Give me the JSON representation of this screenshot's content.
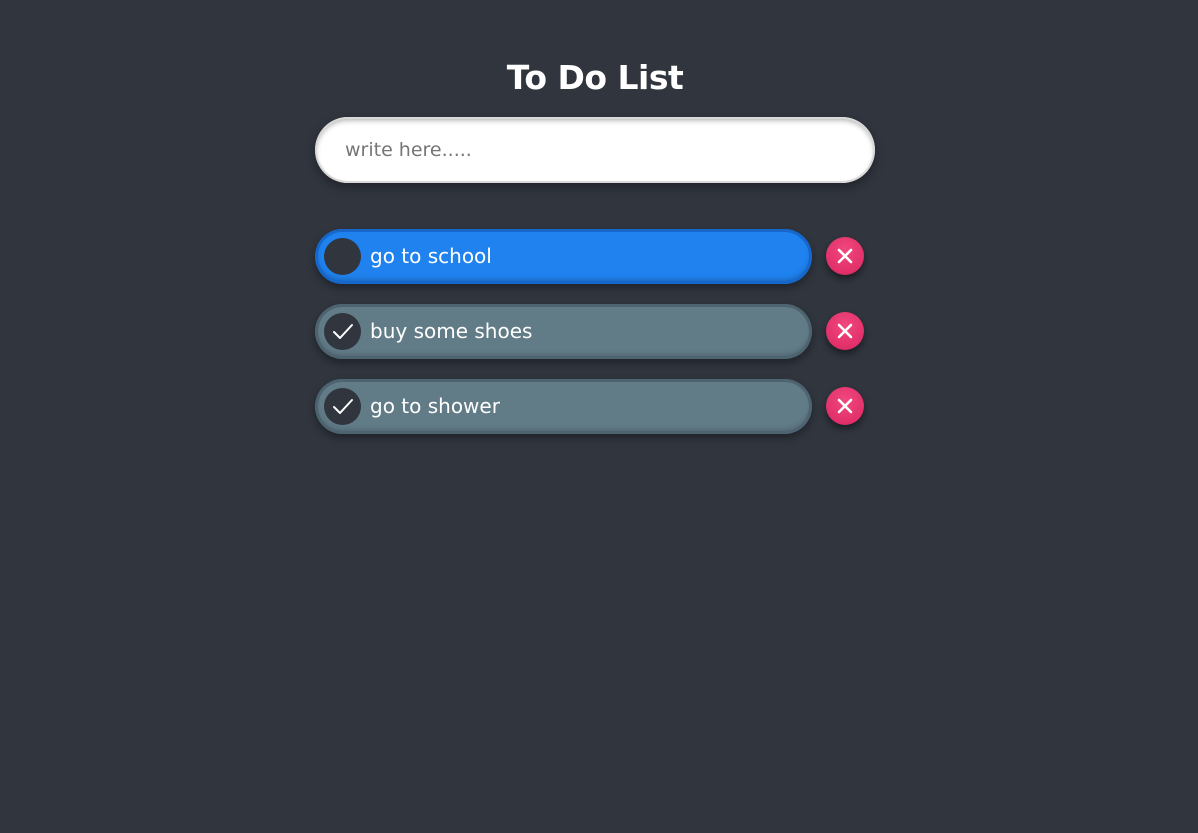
{
  "app": {
    "title": "To Do List"
  },
  "input": {
    "placeholder": "write here.....",
    "value": ""
  },
  "todos": [
    {
      "text": "go to school",
      "completed": false
    },
    {
      "text": "buy some shoes",
      "completed": true
    },
    {
      "text": "go to shower",
      "completed": true
    }
  ],
  "colors": {
    "background": "#30353e",
    "active_item": "#1f82ee",
    "completed_item": "#617b87",
    "delete_button": "#e2306a"
  },
  "icons": {
    "check": "check-icon",
    "delete": "close-icon"
  }
}
